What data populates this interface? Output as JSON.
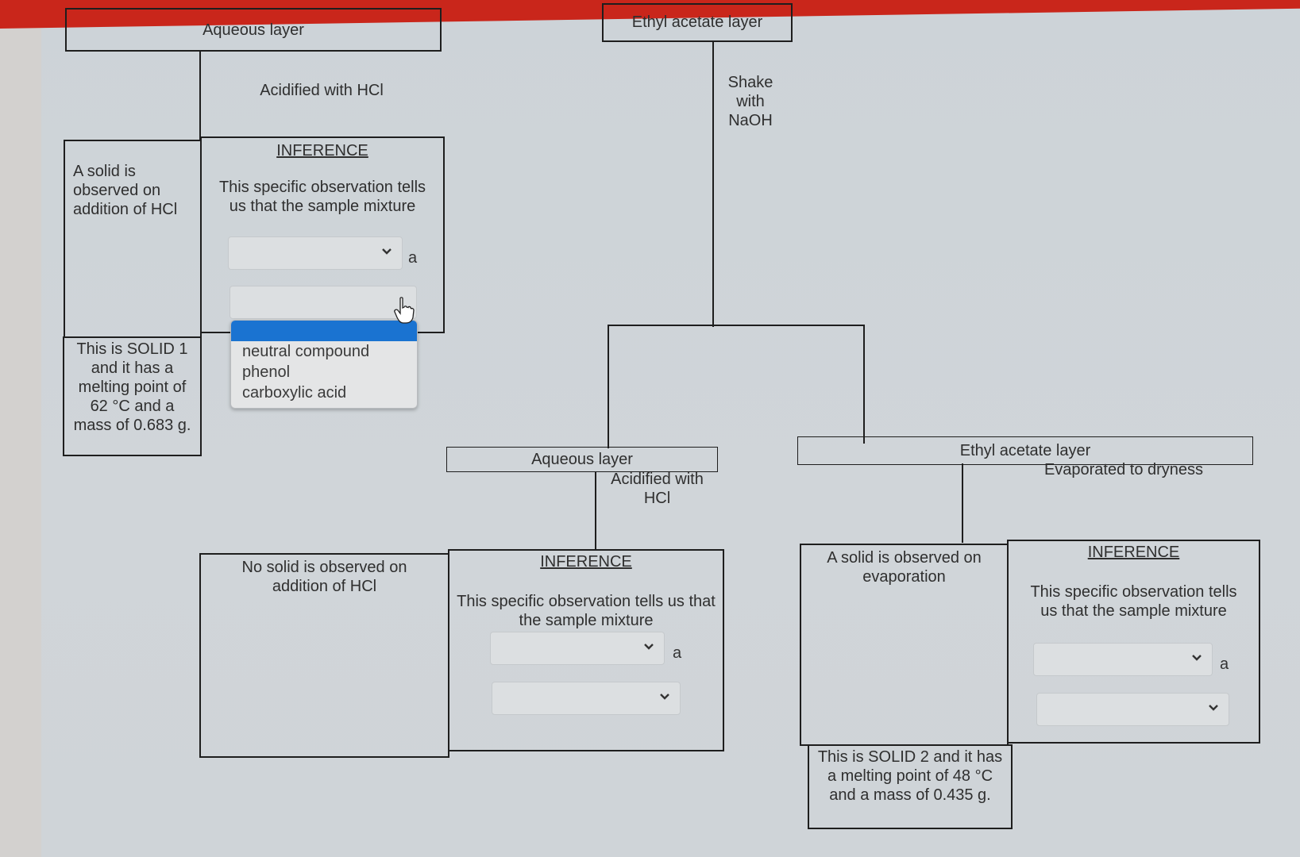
{
  "top_section": {
    "aqueous_layer_label": "Aqueous layer",
    "ethyl_acetate_layer_label": "Ethyl acetate layer",
    "acidified_label": "Acidified with HCl",
    "shake_label_lines": [
      "Shake",
      "with",
      "NaOH"
    ],
    "left_observation": "A solid is observed on addition of HCl",
    "solid1_note": "This is SOLID 1 and it has a melting point of 62 °C and a mass of 0.683 g.",
    "inference": {
      "heading": "INFERENCE",
      "body": "This specific observation tells us that the sample mixture",
      "select1_value": "",
      "article_label": "a",
      "select2_value": "",
      "select2_open": true,
      "select2_options": [
        "",
        "neutral compound",
        "phenol",
        "carboxylic acid"
      ],
      "select2_highlighted_index": 0
    }
  },
  "middle_section": {
    "aqueous_layer_label": "Aqueous layer",
    "acidified_label": "Acidified with HCl",
    "observation": "No solid is observed on addition of HCl",
    "inference": {
      "heading": "INFERENCE",
      "body": "This specific observation tells us that the sample mixture",
      "select1_value": "",
      "article_label": "a",
      "select2_value": ""
    }
  },
  "right_section": {
    "ethyl_acetate_layer_label": "Ethyl acetate layer",
    "evaporated_label": "Evaporated to dryness",
    "observation": "A solid is observed on evaporation",
    "solid2_note": "This is SOLID 2 and it has a melting point of 48 °C and a mass of 0.435 g.",
    "inference": {
      "heading": "INFERENCE",
      "body": "This specific observation tells us that the sample mixture",
      "select1_value": "",
      "article_label": "a",
      "select2_value": ""
    }
  },
  "colors": {
    "banner": "#c9261b",
    "highlight": "#1a73d1",
    "border": "#1e1e1e"
  }
}
